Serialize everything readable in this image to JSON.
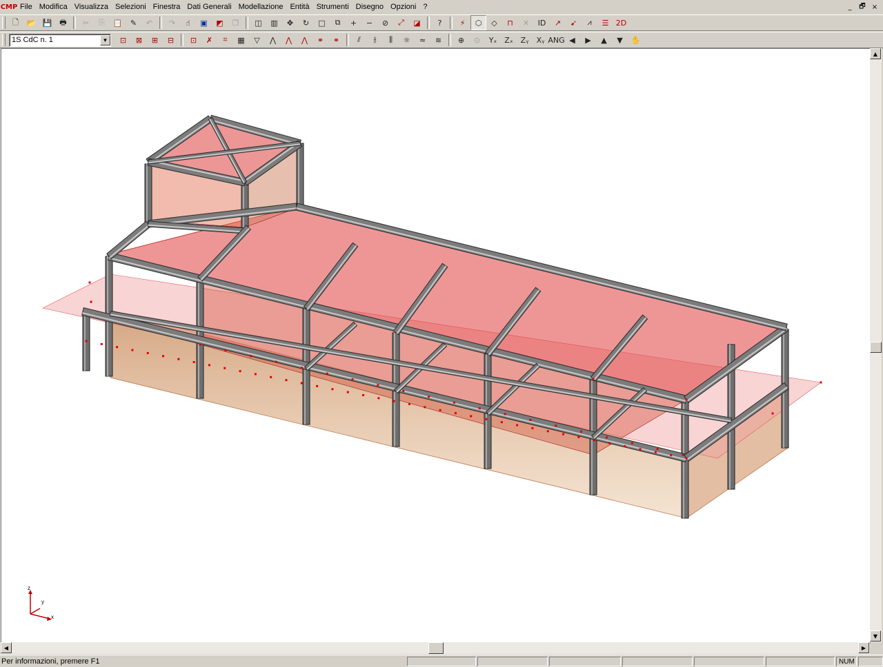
{
  "app": {
    "logo": "CMP"
  },
  "menu": [
    "File",
    "Modifica",
    "Visualizza",
    "Selezioni",
    "Finestra",
    "Dati Generali",
    "Modellazione",
    "Entità",
    "Strumenti",
    "Disegno",
    "Opzioni",
    "?"
  ],
  "window_controls": {
    "minimize": "_",
    "restore": "🗗",
    "close": "×"
  },
  "toolbar1": [
    {
      "name": "new-file",
      "glyph": "🗋"
    },
    {
      "name": "open-folder",
      "glyph": "📂"
    },
    {
      "name": "save",
      "glyph": "💾"
    },
    {
      "name": "print",
      "glyph": "🖶"
    },
    {
      "sep": true
    },
    {
      "name": "cut",
      "glyph": "✂",
      "dis": true
    },
    {
      "name": "copy",
      "glyph": "⎘",
      "dis": true
    },
    {
      "name": "paste",
      "glyph": "📋",
      "dis": true
    },
    {
      "name": "edit-pencil",
      "glyph": "✎"
    },
    {
      "name": "undo",
      "glyph": "↶",
      "dis": true
    },
    {
      "sep": true
    },
    {
      "name": "redo",
      "glyph": "↷",
      "dis": true
    },
    {
      "name": "hand-select",
      "glyph": "☝"
    },
    {
      "name": "zoom-extents",
      "glyph": "▣",
      "cls": "blue"
    },
    {
      "name": "view-pick",
      "glyph": "◩",
      "cls": "red"
    },
    {
      "name": "layers",
      "glyph": "❐",
      "dis": true
    },
    {
      "sep": true
    },
    {
      "name": "window-tile",
      "glyph": "◫"
    },
    {
      "name": "window-split",
      "glyph": "▥"
    },
    {
      "name": "move",
      "glyph": "✥"
    },
    {
      "name": "rotate",
      "glyph": "↻"
    },
    {
      "name": "rectangle",
      "glyph": "□"
    },
    {
      "name": "duplicate",
      "glyph": "⧉"
    },
    {
      "name": "zoom-in",
      "glyph": "+"
    },
    {
      "name": "zoom-out",
      "glyph": "−"
    },
    {
      "name": "no-zoom",
      "glyph": "⊘"
    },
    {
      "name": "tool-a",
      "glyph": "⤢",
      "cls": "red"
    },
    {
      "name": "tool-b",
      "glyph": "◪",
      "cls": "red"
    },
    {
      "sep": true
    },
    {
      "name": "help-pointer",
      "glyph": "?"
    },
    {
      "sep": true
    },
    {
      "name": "wand",
      "glyph": "⚡",
      "cls": "red"
    },
    {
      "name": "solid-view",
      "glyph": "⬡",
      "on": true
    },
    {
      "name": "wire-view",
      "glyph": "◇"
    },
    {
      "name": "frame-view",
      "glyph": "⊓",
      "cls": "red"
    },
    {
      "name": "axis-view",
      "glyph": "✕",
      "dis": true
    },
    {
      "name": "id-label",
      "glyph": "ID"
    },
    {
      "name": "local-axes",
      "glyph": "↗",
      "cls": "red"
    },
    {
      "name": "load-arrow",
      "glyph": "➹",
      "cls": "red"
    },
    {
      "name": "node-view",
      "glyph": "⩘"
    },
    {
      "name": "level-view",
      "glyph": "☰",
      "cls": "red"
    },
    {
      "name": "view-2d",
      "glyph": "2D",
      "cls": "red"
    }
  ],
  "combo": {
    "value": "1S CdC n. 1"
  },
  "toolbar2": [
    {
      "name": "sel-window",
      "glyph": "⊡",
      "cls": "red"
    },
    {
      "name": "sel-cross",
      "glyph": "⊠",
      "cls": "red"
    },
    {
      "name": "sel-frame",
      "glyph": "⊞",
      "cls": "red"
    },
    {
      "name": "sel-clear",
      "glyph": "⊟",
      "cls": "red"
    },
    {
      "sep": true
    },
    {
      "name": "filter-a",
      "glyph": "⊡",
      "cls": "red"
    },
    {
      "name": "filter-b",
      "glyph": "✗",
      "cls": "red"
    },
    {
      "name": "filter-c",
      "glyph": "⌗",
      "cls": "red"
    },
    {
      "name": "filter-d",
      "glyph": "▦"
    },
    {
      "name": "funnel",
      "glyph": "▽"
    },
    {
      "name": "shape-a",
      "glyph": "⋀"
    },
    {
      "name": "shape-b",
      "glyph": "⋀",
      "cls": "red"
    },
    {
      "name": "shape-c",
      "glyph": "⋀",
      "cls": "red"
    },
    {
      "name": "link-a",
      "glyph": "⚭",
      "cls": "red"
    },
    {
      "name": "link-b",
      "glyph": "⚭",
      "cls": "red"
    },
    {
      "sep": true
    },
    {
      "name": "diagram-a",
      "glyph": "⫽"
    },
    {
      "name": "diagram-b",
      "glyph": "⫲"
    },
    {
      "name": "diagram-c",
      "glyph": "⫼"
    },
    {
      "name": "lamp",
      "glyph": "☼"
    },
    {
      "name": "deform-a",
      "glyph": "≈"
    },
    {
      "name": "deform-b",
      "glyph": "≋"
    },
    {
      "sep": true
    },
    {
      "name": "zoom-window",
      "glyph": "⊕"
    },
    {
      "name": "zoom-prev",
      "glyph": "⊙",
      "dis": true
    },
    {
      "name": "view-yx",
      "glyph": "Yₓ"
    },
    {
      "name": "view-zx",
      "glyph": "Zₓ"
    },
    {
      "name": "view-zy",
      "glyph": "Zᵧ"
    },
    {
      "name": "view-xy",
      "glyph": "Xᵧ"
    },
    {
      "name": "angle",
      "glyph": "ANG"
    },
    {
      "name": "step-left",
      "glyph": "◀"
    },
    {
      "name": "step-right",
      "glyph": "▶"
    },
    {
      "name": "level-up",
      "glyph": "▲"
    },
    {
      "name": "level-down",
      "glyph": "▼"
    },
    {
      "name": "pan-hand",
      "glyph": "✋"
    }
  ],
  "axes": {
    "z": "z",
    "y": "y",
    "x": "x"
  },
  "status": {
    "message": "Per informazioni, premere F1",
    "panes": [
      "",
      "",
      "",
      "",
      "",
      "",
      "NUM",
      ""
    ]
  }
}
